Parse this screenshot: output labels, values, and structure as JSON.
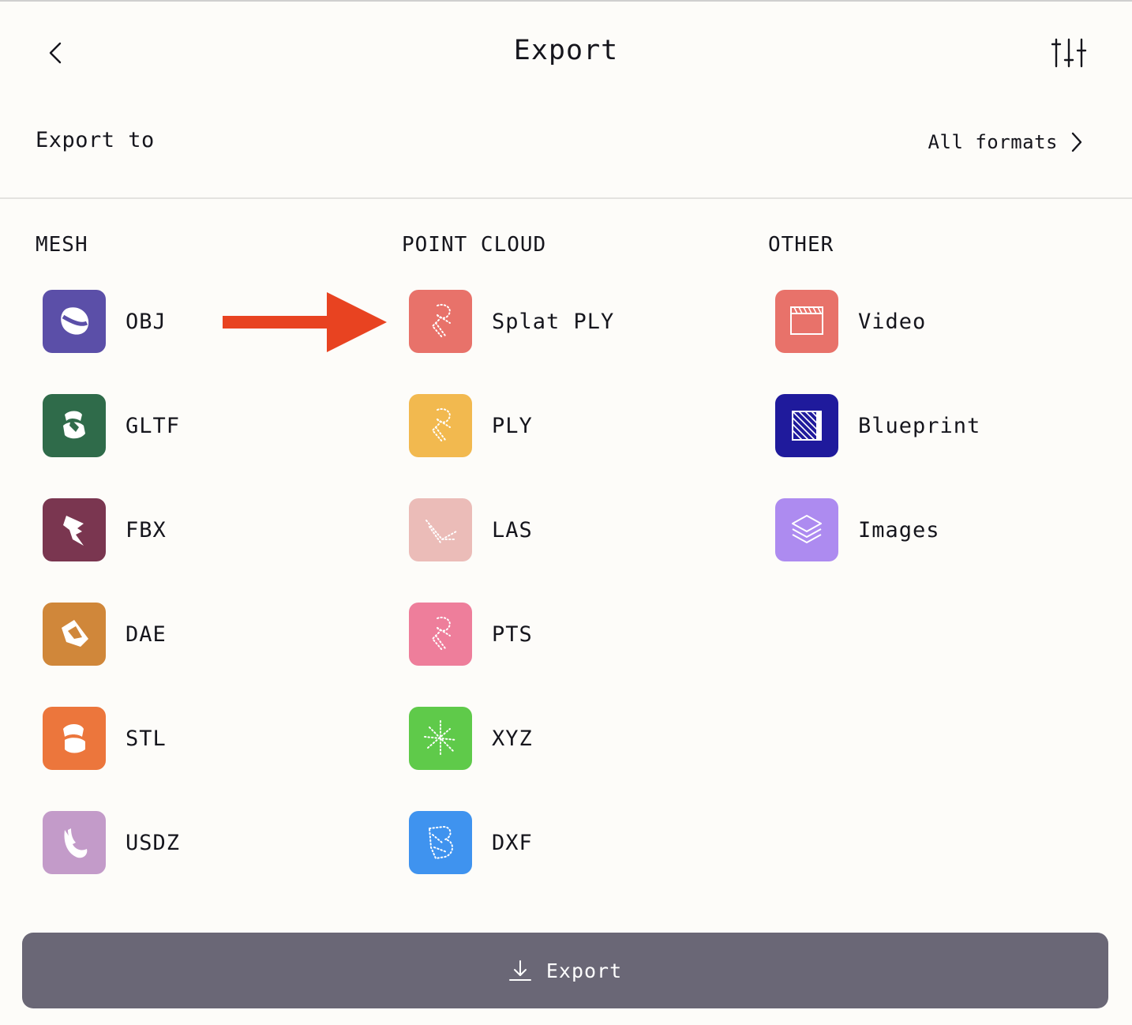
{
  "header": {
    "title": "Export"
  },
  "export_to": {
    "label": "Export to",
    "all_formats_label": "All formats"
  },
  "sections": {
    "mesh": {
      "title": "MESH",
      "items": [
        {
          "label": "OBJ",
          "color": "#5b4fa8",
          "icon": "obj-icon"
        },
        {
          "label": "GLTF",
          "color": "#2f6b4a",
          "icon": "gltf-icon"
        },
        {
          "label": "FBX",
          "color": "#7a3650",
          "icon": "fbx-icon"
        },
        {
          "label": "DAE",
          "color": "#d0873a",
          "icon": "dae-icon"
        },
        {
          "label": "STL",
          "color": "#ec763c",
          "icon": "stl-icon"
        },
        {
          "label": "USDZ",
          "color": "#c39bc9",
          "icon": "usdz-icon"
        }
      ]
    },
    "point_cloud": {
      "title": "POINT CLOUD",
      "items": [
        {
          "label": "Splat PLY",
          "color": "#e8726a",
          "icon": "splat-ply-icon"
        },
        {
          "label": "PLY",
          "color": "#f2b94f",
          "icon": "ply-icon"
        },
        {
          "label": "LAS",
          "color": "#ebbcb8",
          "icon": "las-icon"
        },
        {
          "label": "PTS",
          "color": "#ee7e9b",
          "icon": "pts-icon"
        },
        {
          "label": "XYZ",
          "color": "#5fca4a",
          "icon": "xyz-icon"
        },
        {
          "label": "DXF",
          "color": "#3f93ef",
          "icon": "dxf-icon"
        }
      ]
    },
    "other": {
      "title": "OTHER",
      "items": [
        {
          "label": "Video",
          "color": "#e8726a",
          "icon": "video-clapper-icon"
        },
        {
          "label": "Blueprint",
          "color": "#1f1a9c",
          "icon": "blueprint-icon"
        },
        {
          "label": "Images",
          "color": "#ad8bf0",
          "icon": "image-layers-icon"
        }
      ]
    }
  },
  "annotation": {
    "arrow_color": "#e84321"
  },
  "footer": {
    "export_button_label": "Export",
    "button_color": "#6a6776"
  }
}
